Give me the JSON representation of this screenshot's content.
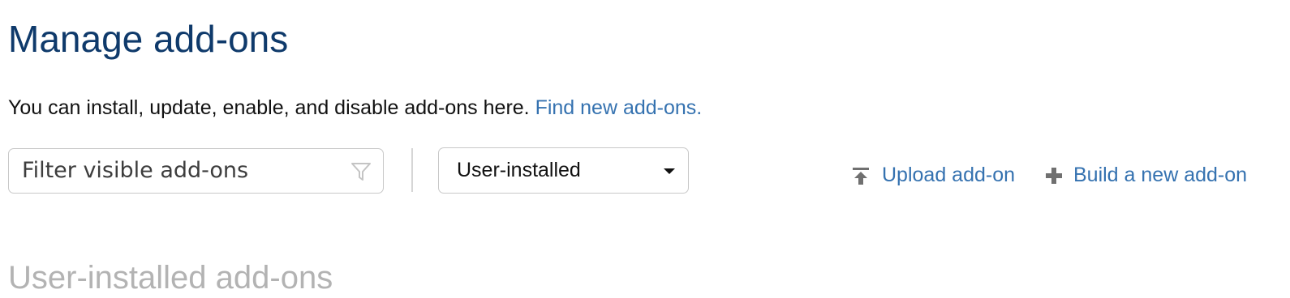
{
  "page": {
    "title": "Manage add-ons",
    "intro_text": "You can install, update, enable, and disable add-ons here.",
    "find_link": "Find new add-ons."
  },
  "toolbar": {
    "filter_placeholder": "Filter visible add-ons",
    "filter_icon": "funnel-filter-icon",
    "select_value": "User-installed",
    "upload_label": "Upload add-on",
    "upload_icon": "upload-arrow-icon",
    "build_label": "Build a new add-on",
    "build_icon": "plus-icon"
  },
  "section": {
    "heading": "User-installed add-ons"
  },
  "colors": {
    "title": "#0f3a6b",
    "link": "#3572b0",
    "body_text": "#111111",
    "border": "#c8c8c8",
    "faded_heading": "#b3b3b3"
  }
}
